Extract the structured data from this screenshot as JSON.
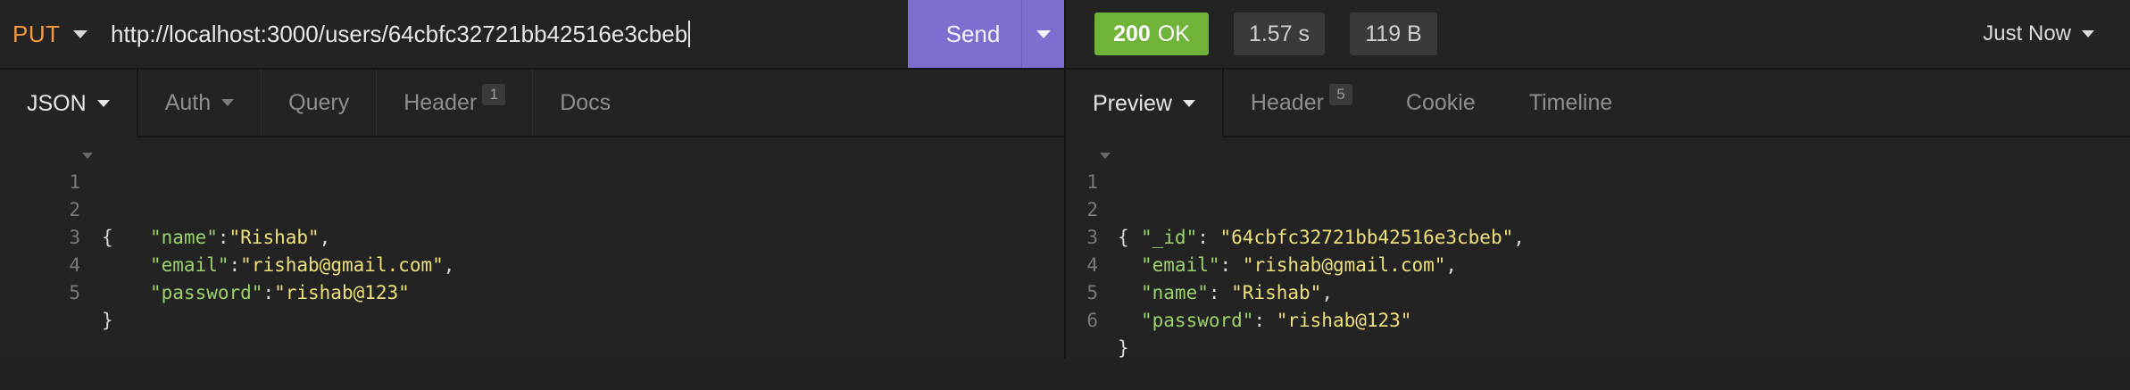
{
  "request": {
    "method": "PUT",
    "url": "http://localhost:3000/users/64cbfc32721bb42516e3cbeb",
    "send_label": "Send",
    "tabs": [
      {
        "label": "JSON",
        "active": true
      },
      {
        "label": "Auth"
      },
      {
        "label": "Query"
      },
      {
        "label": "Header",
        "badge": "1"
      },
      {
        "label": "Docs"
      }
    ],
    "body_lines": [
      {
        "n": "1",
        "text": "{"
      },
      {
        "n": "2",
        "key": "\"name\"",
        "sep": ":",
        "value": "\"Rishab\"",
        "end": ","
      },
      {
        "n": "3",
        "key": "\"email\"",
        "sep": ":",
        "value": "\"rishab@gmail.com\"",
        "end": ","
      },
      {
        "n": "4",
        "key": "\"password\"",
        "sep": ":",
        "value": "\"rishab@123\"",
        "end": ""
      },
      {
        "n": "5",
        "text": "}"
      }
    ]
  },
  "response": {
    "status_code": "200",
    "status_text": "OK",
    "time": "1.57 s",
    "size": "119 B",
    "history_label": "Just Now",
    "tabs": [
      {
        "label": "Preview",
        "active": true
      },
      {
        "label": "Header",
        "badge": "5"
      },
      {
        "label": "Cookie"
      },
      {
        "label": "Timeline"
      }
    ],
    "body_lines": [
      {
        "n": "1",
        "text": "{"
      },
      {
        "n": "2",
        "key": "\"_id\"",
        "sep": ": ",
        "value": "\"64cbfc32721bb42516e3cbeb\"",
        "end": ","
      },
      {
        "n": "3",
        "key": "\"email\"",
        "sep": ": ",
        "value": "\"rishab@gmail.com\"",
        "end": ","
      },
      {
        "n": "4",
        "key": "\"name\"",
        "sep": ": ",
        "value": "\"Rishab\"",
        "end": ","
      },
      {
        "n": "5",
        "key": "\"password\"",
        "sep": ": ",
        "value": "\"rishab@123\"",
        "end": ""
      },
      {
        "n": "6",
        "text": "}"
      }
    ]
  },
  "colors": {
    "method": "#f19a42",
    "send": "#7d6fcf",
    "status_ok": "#6fb338",
    "json_key": "#9cd26c",
    "json_string": "#efe07a"
  }
}
